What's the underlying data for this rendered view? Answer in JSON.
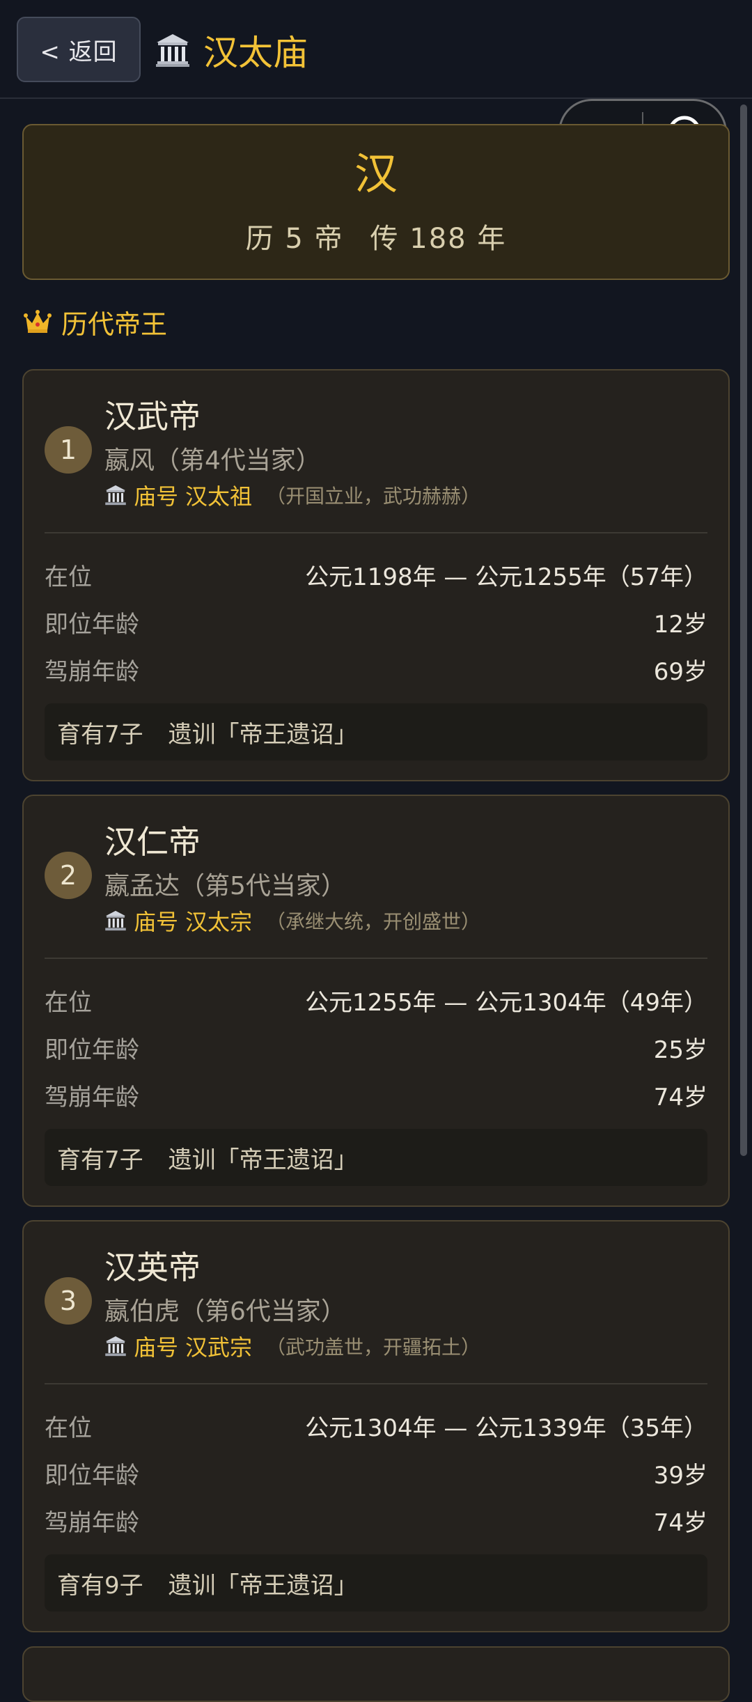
{
  "header": {
    "back_label": "< 返回",
    "title": "汉太庙"
  },
  "dynasty": {
    "name": "汉",
    "stat_emperors": "历 5 帝",
    "stat_years": "传 188 年"
  },
  "section": {
    "title": "历代帝王"
  },
  "labels": {
    "reign": "在位",
    "accession_age": "即位年龄",
    "death_age": "驾崩年龄",
    "temple_prefix": "庙号"
  },
  "emperors": [
    {
      "index": "1",
      "name": "汉武帝",
      "clan": "嬴风（第4代当家）",
      "temple_name": "汉太祖",
      "temple_desc": "（开国立业，武功赫赫）",
      "reign": "公元1198年 — 公元1255年（57年）",
      "accession_age": "12岁",
      "death_age": "69岁",
      "children": "育有7子",
      "legacy": "遗训「帝王遗诏」"
    },
    {
      "index": "2",
      "name": "汉仁帝",
      "clan": "嬴孟达（第5代当家）",
      "temple_name": "汉太宗",
      "temple_desc": "（承继大统，开创盛世）",
      "reign": "公元1255年 — 公元1304年（49年）",
      "accession_age": "25岁",
      "death_age": "74岁",
      "children": "育有7子",
      "legacy": "遗训「帝王遗诏」"
    },
    {
      "index": "3",
      "name": "汉英帝",
      "clan": "嬴伯虎（第6代当家）",
      "temple_name": "汉武宗",
      "temple_desc": "（武功盖世，开疆拓土）",
      "reign": "公元1304年 — 公元1339年（35年）",
      "accession_age": "39岁",
      "death_age": "74岁",
      "children": "育有9子",
      "legacy": "遗训「帝王遗诏」"
    }
  ],
  "icons": {
    "temple": "classical-building-icon",
    "crown": "crown-icon",
    "more": "more-dots-icon",
    "close": "target-close-icon"
  },
  "colors": {
    "accent_gold": "#f2c237",
    "background": "#121620",
    "card": "#25221e",
    "dynasty_card": "#2d2717"
  }
}
